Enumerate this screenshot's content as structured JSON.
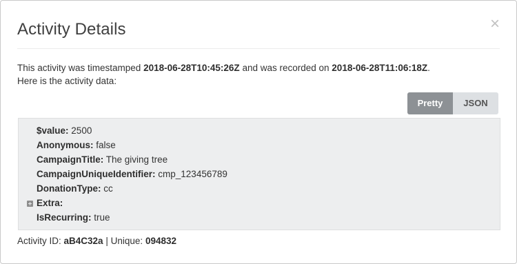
{
  "modal": {
    "title": "Activity Details",
    "close_label": "×"
  },
  "description": {
    "line1_prefix": "This activity was timestamped",
    "timestamped": "2018-06-28T10:45:26Z",
    "line1_middle": "and was recorded on",
    "recorded": "2018-06-28T11:06:18Z",
    "line1_suffix": ".",
    "line2": "Here is the activity data:"
  },
  "view_toggle": {
    "pretty_label": "Pretty",
    "json_label": "JSON",
    "selected": "Pretty"
  },
  "activity_data": [
    {
      "key": "$value:",
      "value": "2500",
      "expandable": false
    },
    {
      "key": "Anonymous:",
      "value": "false",
      "expandable": false
    },
    {
      "key": "CampaignTitle:",
      "value": "The giving tree",
      "expandable": false
    },
    {
      "key": "CampaignUniqueIdentifier:",
      "value": "cmp_123456789",
      "expandable": false
    },
    {
      "key": "DonationType:",
      "value": "cc",
      "expandable": false
    },
    {
      "key": "Extra:",
      "value": "",
      "expandable": true
    },
    {
      "key": "IsRecurring:",
      "value": "true",
      "expandable": false
    }
  ],
  "footer": {
    "activity_id_label": "Activity ID:",
    "activity_id": "aB4C32a",
    "separator": "|",
    "unique_label": "Unique:",
    "unique": "094832"
  }
}
